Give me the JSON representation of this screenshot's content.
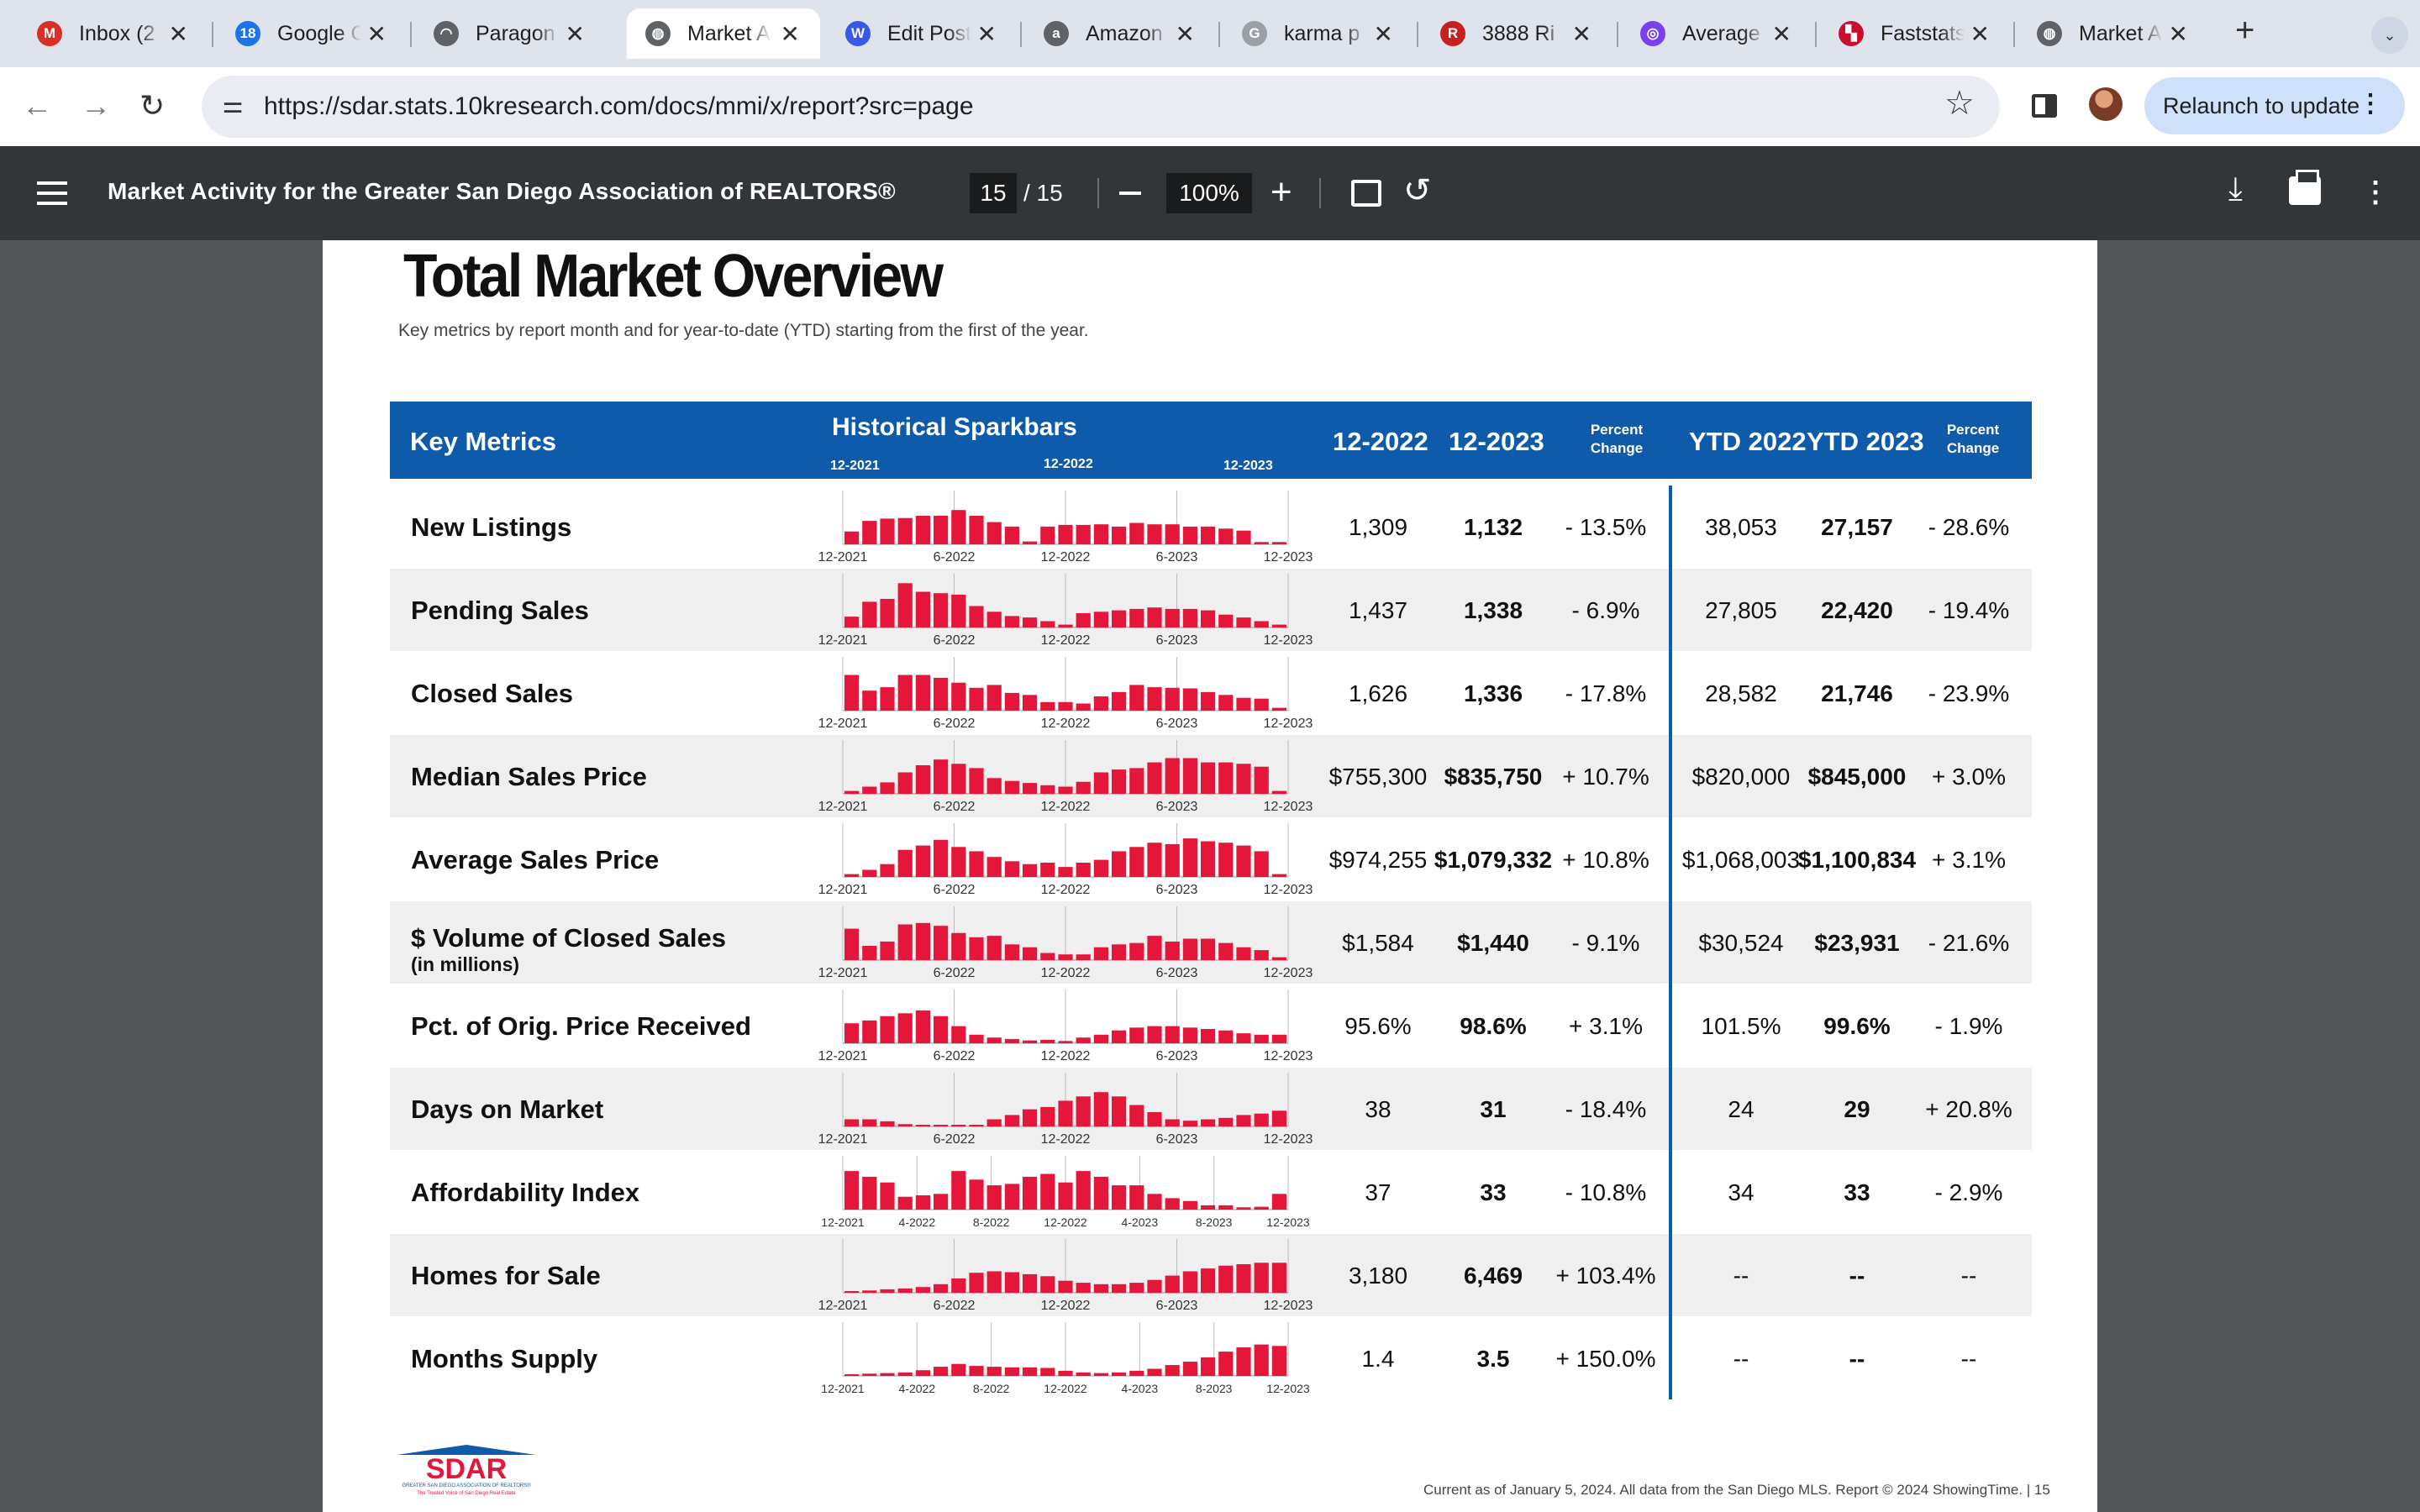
{
  "browser": {
    "tabs": [
      {
        "title": "Inbox (2",
        "icon": "gmail-icon",
        "color": "#d93025",
        "glyph": "M"
      },
      {
        "title": "Google C",
        "icon": "calendar-icon",
        "color": "#1a73e8",
        "glyph": "18"
      },
      {
        "title": "Paragon",
        "icon": "paragon-icon",
        "color": "#5f6368",
        "glyph": "◠"
      },
      {
        "title": "Market A",
        "icon": "globe-icon",
        "color": "#5f6368",
        "glyph": "◍",
        "active": true
      },
      {
        "title": "Edit Post",
        "icon": "wordpress-icon",
        "color": "#3858e9",
        "glyph": "W"
      },
      {
        "title": "Amazon",
        "icon": "amazon-icon",
        "color": "#5f6368",
        "glyph": "a"
      },
      {
        "title": "karma p",
        "icon": "google-icon",
        "color": "#9aa0a6",
        "glyph": "G"
      },
      {
        "title": "3888 Ri",
        "icon": "redfin-icon",
        "color": "#c82021",
        "glyph": "R"
      },
      {
        "title": "Average",
        "icon": "average-icon",
        "color": "#7b3ff2",
        "glyph": "◎"
      },
      {
        "title": "Faststats",
        "icon": "faststats-icon",
        "color": "#c8102e",
        "glyph": "▚"
      },
      {
        "title": "Market A",
        "icon": "globe-icon",
        "color": "#5f6368",
        "glyph": "◍"
      }
    ],
    "url": "https://sdar.stats.10kresearch.com/docs/mmi/x/report?src=page",
    "relaunch_label": "Relaunch to update"
  },
  "pdf_viewer": {
    "title": "Market Activity for the Greater San Diego Association of REALTORS®",
    "page_current": "15",
    "page_total": "/ 15",
    "zoom": "100%"
  },
  "report": {
    "title": "Total Market Overview",
    "subtitle": "Key metrics by report month and for year-to-date (YTD) starting from the first of the year.",
    "header": {
      "key_metrics": "Key Metrics",
      "sparkbars": "Historical Sparkbars",
      "spark_ticks": [
        "12-2021",
        "12-2022",
        "12-2023"
      ],
      "col_1": "12-2022",
      "col_2": "12-2023",
      "pct_1": "Percent",
      "pct_1b": "Change",
      "col_3": "YTD 2022",
      "col_4": "YTD 2023",
      "pct_2": "Percent",
      "pct_2b": "Change"
    },
    "rows": [
      {
        "label": "New Listings",
        "sublabel": "",
        "m2022": "1,309",
        "m2023": "1,132",
        "pct": "- 13.5%",
        "ytd2022": "38,053",
        "ytd2023": "27,157",
        "ytdpct": "- 28.6%",
        "axis": [
          "12-2021",
          "6-2022",
          "12-2022",
          "6-2023",
          "12-2023"
        ],
        "bars": [
          0.45,
          0.82,
          0.9,
          0.92,
          1.0,
          1.0,
          1.2,
          1.0,
          0.78,
          0.62,
          0.1,
          0.62,
          0.68,
          0.68,
          0.7,
          0.62,
          0.75,
          0.7,
          0.7,
          0.62,
          0.62,
          0.55,
          0.48,
          0.08,
          0.08
        ]
      },
      {
        "label": "Pending Sales",
        "sublabel": "",
        "m2022": "1,437",
        "m2023": "1,338",
        "pct": "- 6.9%",
        "ytd2022": "27,805",
        "ytd2023": "22,420",
        "ytdpct": "- 19.4%",
        "axis": [
          "12-2021",
          "6-2022",
          "12-2022",
          "6-2023",
          "12-2023"
        ],
        "bars": [
          0.38,
          0.9,
          1.0,
          1.55,
          1.25,
          1.2,
          1.15,
          0.75,
          0.55,
          0.4,
          0.35,
          0.22,
          0.1,
          0.5,
          0.55,
          0.6,
          0.65,
          0.7,
          0.65,
          0.65,
          0.6,
          0.45,
          0.35,
          0.22,
          0.1
        ]
      },
      {
        "label": "Closed Sales",
        "sublabel": "",
        "m2022": "1,626",
        "m2023": "1,336",
        "pct": "- 17.8%",
        "ytd2022": "28,582",
        "ytd2023": "21,746",
        "ytdpct": "- 23.9%",
        "axis": [
          "12-2021",
          "6-2022",
          "12-2022",
          "6-2023",
          "12-2023"
        ],
        "bars": [
          1.25,
          0.7,
          0.82,
          1.25,
          1.25,
          1.15,
          0.98,
          0.8,
          0.9,
          0.62,
          0.55,
          0.3,
          0.3,
          0.25,
          0.5,
          0.65,
          0.9,
          0.82,
          0.8,
          0.78,
          0.65,
          0.55,
          0.45,
          0.42,
          0.1
        ]
      },
      {
        "label": "Median Sales Price",
        "sublabel": "",
        "m2022": "$755,300",
        "m2023": "$835,750",
        "pct": "+ 10.7%",
        "ytd2022": "$820,000",
        "ytd2023": "$845,000",
        "ytdpct": "+ 3.0%",
        "axis": [
          "12-2021",
          "6-2022",
          "12-2022",
          "6-2023",
          "12-2023"
        ],
        "bars": [
          0.1,
          0.25,
          0.4,
          0.75,
          1.0,
          1.2,
          1.05,
          0.9,
          0.55,
          0.45,
          0.38,
          0.3,
          0.25,
          0.42,
          0.75,
          0.85,
          0.9,
          1.1,
          1.25,
          1.25,
          1.1,
          1.1,
          1.05,
          0.95,
          0.1
        ]
      },
      {
        "label": "Average Sales Price",
        "sublabel": "",
        "m2022": "$974,255",
        "m2023": "$1,079,332",
        "pct": "+ 10.8%",
        "ytd2022": "$1,068,003",
        "ytd2023": "$1,100,834",
        "ytdpct": "+ 3.1%",
        "axis": [
          "12-2021",
          "6-2022",
          "12-2022",
          "6-2023",
          "12-2023"
        ],
        "bars": [
          0.1,
          0.25,
          0.45,
          0.95,
          1.1,
          1.3,
          1.05,
          0.9,
          0.7,
          0.55,
          0.45,
          0.5,
          0.35,
          0.5,
          0.6,
          0.9,
          1.05,
          1.2,
          1.15,
          1.35,
          1.25,
          1.2,
          1.1,
          0.9,
          0.1
        ]
      },
      {
        "label": "$ Volume of Closed Sales",
        "sublabel": "(in millions)",
        "m2022": "$1,584",
        "m2023": "$1,440",
        "pct": "- 9.1%",
        "ytd2022": "$30,524",
        "ytd2023": "$23,931",
        "ytdpct": "- 21.6%",
        "axis": [
          "12-2021",
          "6-2022",
          "12-2022",
          "6-2023",
          "12-2023"
        ],
        "bars": [
          1.1,
          0.5,
          0.65,
          1.25,
          1.3,
          1.2,
          0.95,
          0.8,
          0.85,
          0.55,
          0.45,
          0.25,
          0.2,
          0.2,
          0.45,
          0.55,
          0.6,
          0.85,
          0.65,
          0.75,
          0.75,
          0.6,
          0.45,
          0.35,
          0.1
        ]
      },
      {
        "label": "Pct. of Orig. Price Received",
        "sublabel": "",
        "m2022": "95.6%",
        "m2023": "98.6%",
        "pct": "+ 3.1%",
        "ytd2022": "101.5%",
        "ytd2023": "99.6%",
        "ytdpct": "- 1.9%",
        "axis": [
          "12-2021",
          "6-2022",
          "12-2022",
          "6-2023",
          "12-2023"
        ],
        "bars": [
          0.7,
          0.8,
          0.95,
          1.05,
          1.15,
          0.95,
          0.6,
          0.3,
          0.2,
          0.15,
          0.1,
          0.12,
          0.08,
          0.2,
          0.3,
          0.45,
          0.55,
          0.6,
          0.6,
          0.55,
          0.5,
          0.45,
          0.35,
          0.3,
          0.3
        ]
      },
      {
        "label": "Days on Market",
        "sublabel": "",
        "m2022": "38",
        "m2023": "31",
        "pct": "- 18.4%",
        "ytd2022": "24",
        "ytd2023": "29",
        "ytdpct": "+ 20.8%",
        "axis": [
          "12-2021",
          "6-2022",
          "12-2022",
          "6-2023",
          "12-2023"
        ],
        "bars": [
          0.25,
          0.25,
          0.18,
          0.08,
          0.06,
          0.04,
          0.05,
          0.06,
          0.25,
          0.4,
          0.6,
          0.68,
          0.9,
          1.05,
          1.2,
          1.05,
          0.75,
          0.5,
          0.25,
          0.2,
          0.25,
          0.3,
          0.4,
          0.45,
          0.55
        ]
      },
      {
        "label": "Affordability Index",
        "sublabel": "",
        "m2022": "37",
        "m2023": "33",
        "pct": "- 10.8%",
        "ytd2022": "34",
        "ytd2023": "33",
        "ytdpct": "- 2.9%",
        "axis": [
          "12-2021",
          "4-2022",
          "8-2022",
          "12-2022",
          "4-2023",
          "8-2023",
          "12-2023"
        ],
        "bars": [
          1.35,
          1.15,
          0.95,
          0.45,
          0.5,
          0.55,
          1.35,
          1.05,
          0.85,
          0.9,
          1.15,
          1.25,
          0.95,
          1.35,
          1.15,
          0.85,
          0.85,
          0.55,
          0.4,
          0.3,
          0.15,
          0.15,
          0.08,
          0.1,
          0.55
        ]
      },
      {
        "label": "Homes for Sale",
        "sublabel": "",
        "m2022": "3,180",
        "m2023": "6,469",
        "pct": "+ 103.4%",
        "ytd2022": "--",
        "ytd2023": "--",
        "ytdpct": "--",
        "axis": [
          "12-2021",
          "6-2022",
          "12-2022",
          "6-2023",
          "12-2023"
        ],
        "bars": [
          0.05,
          0.08,
          0.12,
          0.15,
          0.2,
          0.3,
          0.5,
          0.7,
          0.75,
          0.72,
          0.65,
          0.58,
          0.42,
          0.35,
          0.3,
          0.3,
          0.35,
          0.45,
          0.6,
          0.75,
          0.85,
          0.95,
          1.0,
          1.05,
          1.05
        ]
      },
      {
        "label": "Months Supply",
        "sublabel": "",
        "m2022": "1.4",
        "m2023": "3.5",
        "pct": "+ 150.0%",
        "ytd2022": "--",
        "ytd2023": "--",
        "ytdpct": "--",
        "axis": [
          "12-2021",
          "4-2022",
          "8-2022",
          "12-2022",
          "4-2023",
          "8-2023",
          "12-2023"
        ],
        "bars": [
          0.05,
          0.08,
          0.1,
          0.12,
          0.2,
          0.32,
          0.42,
          0.35,
          0.32,
          0.3,
          0.3,
          0.28,
          0.18,
          0.12,
          0.1,
          0.12,
          0.18,
          0.25,
          0.38,
          0.5,
          0.65,
          0.85,
          1.0,
          1.1,
          1.05
        ]
      }
    ],
    "footer": "Current as of January 5, 2024. All data from the San Diego MLS. Report © 2024 ShowingTime.  |  15",
    "logo_text": "SDAR",
    "logo_sub1": "GREATER SAN DIEGO ASSOCIATION OF REALTORS®",
    "logo_sub2": "The Trusted Voice of San Diego Real Estate",
    "bar_color": "#e4163a",
    "header_color": "#0e5aab"
  }
}
